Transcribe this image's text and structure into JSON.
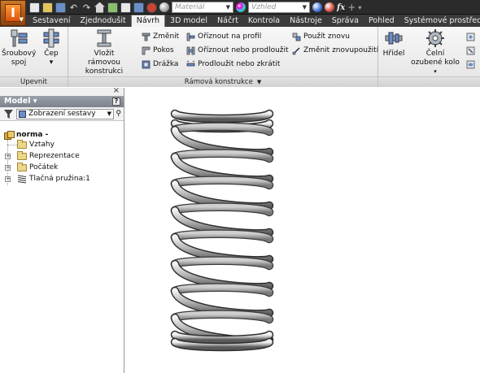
{
  "qat": {
    "app_letter": "I",
    "material_value": "Materiál",
    "appearance_value": "Vzhled",
    "fx_label": "fx"
  },
  "tabs": [
    {
      "label": "Sestavení",
      "active": false
    },
    {
      "label": "Zjednodušit",
      "active": false
    },
    {
      "label": "Návrh",
      "active": true
    },
    {
      "label": "3D model",
      "active": false
    },
    {
      "label": "Náčrt",
      "active": false
    },
    {
      "label": "Kontrola",
      "active": false
    },
    {
      "label": "Nástroje",
      "active": false
    },
    {
      "label": "Správa",
      "active": false
    },
    {
      "label": "Pohled",
      "active": false
    },
    {
      "label": "Systémové prostředí",
      "active": false
    }
  ],
  "ribbon": {
    "upevnit": {
      "title": "Upevnit",
      "sroubovy_line1": "Šroubový",
      "sroubovy_line2": "spoj",
      "cep_label": "Čep",
      "cep_arrow": "▾"
    },
    "ramova": {
      "title": "Rámová konstrukce",
      "vlozit_line1": "Vložit",
      "vlozit_line2": "rámovou konstrukci",
      "zmenit": "Změnit",
      "pokos": "Pokos",
      "drazka": "Drážka",
      "oriznout_profil": "Oříznout na profil",
      "oriznout_prodlouzit": "Oříznout nebo prodloužit",
      "prodlouzit_zkratit": "Prodloužit nebo zkrátit",
      "pouzit_znovu": "Použít znovu",
      "zmenit_znovupouziti": "Změnit znovupoužití"
    },
    "power": {
      "hridel": "Hřídel",
      "celni_line1": "Čelní",
      "celni_line2": "ozubené kolo"
    }
  },
  "browser": {
    "title": "Model",
    "title_arrow": "▾",
    "help": "?",
    "view_select": "Zobrazení sestavy",
    "tree": {
      "root": "norma -",
      "items": [
        {
          "label": "Vztahy",
          "expandable": false
        },
        {
          "label": "Reprezentace",
          "expandable": true
        },
        {
          "label": "Počátek",
          "expandable": true
        },
        {
          "label": "Tlačná pružina:1",
          "expandable": true
        }
      ]
    }
  },
  "viewport": {
    "model": "compression-spring",
    "coil_count": 8
  }
}
